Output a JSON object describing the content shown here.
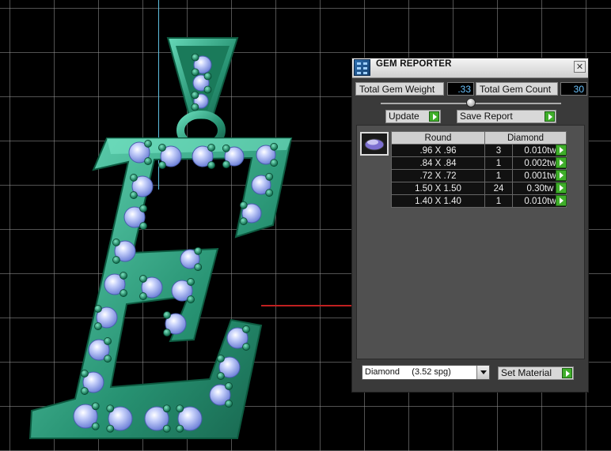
{
  "window": {
    "title": "GEM REPORTER",
    "close_glyph": "✕"
  },
  "totals": {
    "weight_label": "Total Gem Weight",
    "weight_value": ".33",
    "count_label": "Total Gem Count",
    "count_value": "30"
  },
  "toolbar": {
    "update_label": "Update",
    "save_report_label": "Save Report"
  },
  "table": {
    "headers": [
      "Round",
      "Diamond"
    ],
    "rows": [
      {
        "size": ".96 X .96",
        "count": "3",
        "weight": "0.010tw"
      },
      {
        "size": ".84 X .84",
        "count": "1",
        "weight": "0.002tw"
      },
      {
        "size": ".72 X .72",
        "count": "1",
        "weight": "0.001tw"
      },
      {
        "size": "1.50 X 1.50",
        "count": "24",
        "weight": "0.30tw"
      },
      {
        "size": "1.40 X 1.40",
        "count": "1",
        "weight": "0.010tw"
      }
    ]
  },
  "material": {
    "selected": "Diamond     (3.52 spg)",
    "set_label": "Set Material"
  },
  "icons": {
    "app": "gem-reporter-app-icon",
    "close": "close-icon",
    "row_action": "green-arrow-icon",
    "dropdown": "chevron-down-icon"
  },
  "colors": {
    "metal": "#2fa57e",
    "metal_light": "#6fe0c0",
    "gem": "#b9c6f5",
    "grid": "#8c8c8c",
    "accent_value": "#6cc4ff",
    "arrow_green": "#3fae2a"
  }
}
